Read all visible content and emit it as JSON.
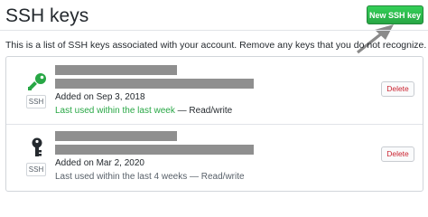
{
  "header": {
    "title": "SSH keys",
    "new_button_label": "New SSH key"
  },
  "description": "This is a list of SSH keys associated with your account. Remove any keys that you do not recognize.",
  "keys": [
    {
      "badge": "SSH",
      "added": "Added on Sep 3, 2018",
      "last_used": "Last used within the last week",
      "access": " — Read/write",
      "delete_label": "Delete",
      "icon_color": "#28a745",
      "last_used_color": "#28a745"
    },
    {
      "badge": "SSH",
      "added": "Added on Mar 2, 2020",
      "last_used": "Last used within the last 4 weeks",
      "access": " — Read/write",
      "delete_label": "Delete",
      "icon_color": "#24292e",
      "last_used_color": "#586069"
    }
  ],
  "colors": {
    "primary_button": "#2ea44f",
    "danger": "#cb2431"
  }
}
